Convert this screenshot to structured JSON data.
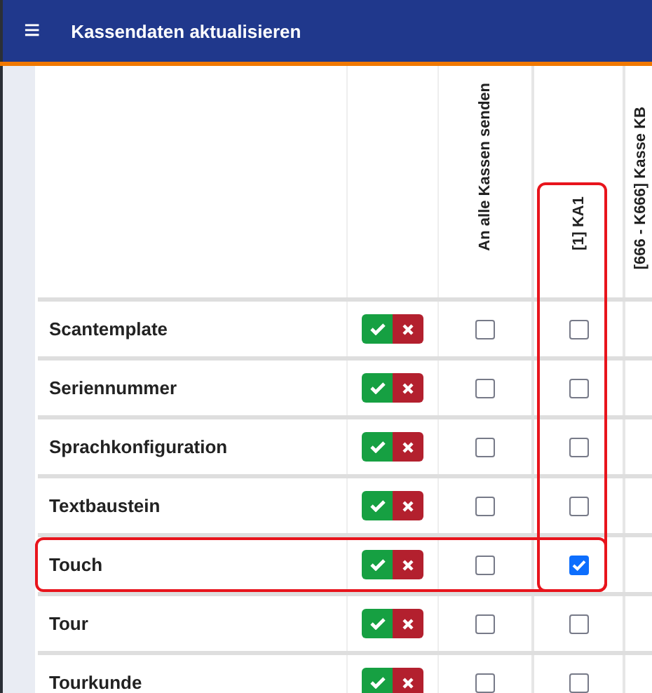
{
  "app_bar": {
    "menu_icon": "≡",
    "title": "Kassendaten aktualisieren"
  },
  "table": {
    "columns": [
      {
        "label": "An alle Kassen senden",
        "highlighted": false
      },
      {
        "label": "[1] KA1",
        "highlighted": true
      },
      {
        "label": "[666 - K666] Kasse KB",
        "highlighted": false
      }
    ],
    "rows": [
      {
        "name": "Scantemplate",
        "highlighted": false,
        "checks": [
          false,
          false
        ]
      },
      {
        "name": "Seriennummer",
        "highlighted": false,
        "checks": [
          false,
          false
        ]
      },
      {
        "name": "Sprachkonfiguration",
        "highlighted": false,
        "checks": [
          false,
          false
        ]
      },
      {
        "name": "Textbaustein",
        "highlighted": false,
        "checks": [
          false,
          false
        ]
      },
      {
        "name": "Touch",
        "highlighted": true,
        "checks": [
          false,
          true
        ]
      },
      {
        "name": "Tour",
        "highlighted": false,
        "checks": [
          false,
          false
        ]
      },
      {
        "name": "Tourkunde",
        "highlighted": false,
        "checks": [
          false,
          false
        ]
      }
    ]
  }
}
